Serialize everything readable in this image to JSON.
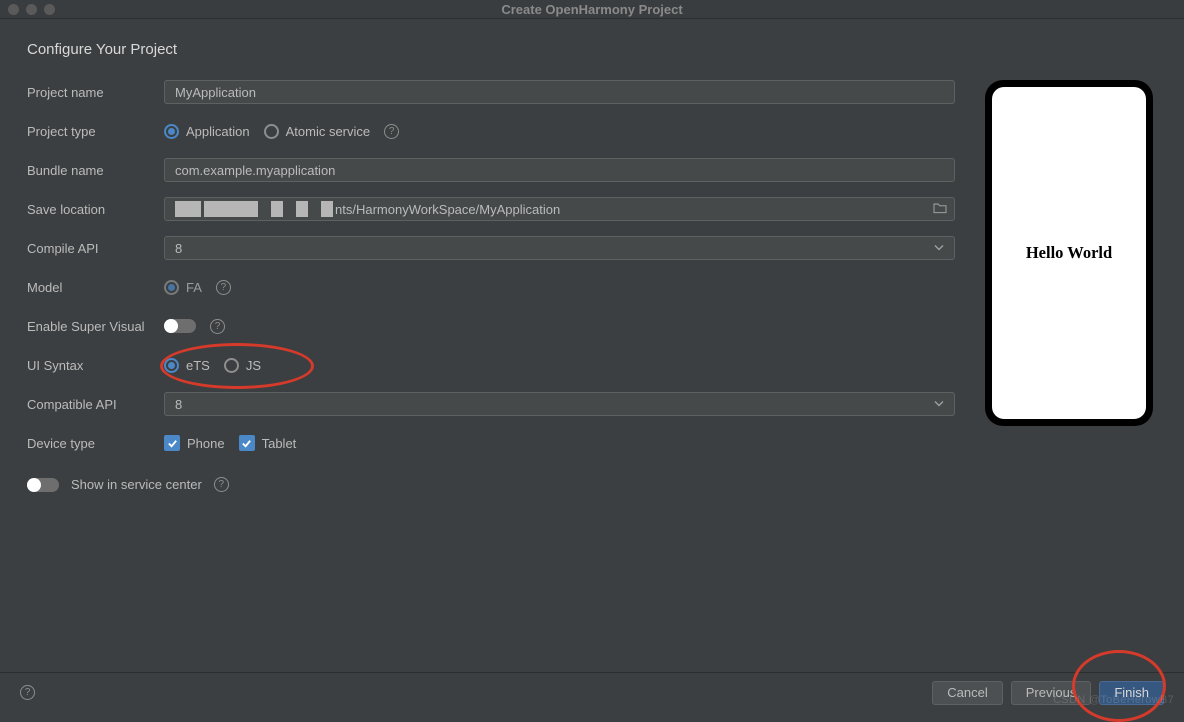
{
  "window": {
    "title": "Create OpenHarmony Project"
  },
  "page": {
    "title": "Configure Your Project"
  },
  "form": {
    "project_name_label": "Project name",
    "project_name_value": "MyApplication",
    "project_type_label": "Project type",
    "project_type_options": {
      "application": "Application",
      "atomic_service": "Atomic service"
    },
    "bundle_name_label": "Bundle name",
    "bundle_name_value": "com.example.myapplication",
    "save_location_label": "Save location",
    "save_location_tail": "nts/HarmonyWorkSpace/MyApplication",
    "compile_api_label": "Compile API",
    "compile_api_value": "8",
    "model_label": "Model",
    "model_options": {
      "fa": "FA"
    },
    "super_visual_label": "Enable Super Visual",
    "ui_syntax_label": "UI Syntax",
    "ui_syntax_options": {
      "ets": "eTS",
      "js": "JS"
    },
    "compatible_api_label": "Compatible API",
    "compatible_api_value": "8",
    "device_type_label": "Device type",
    "device_type_options": {
      "phone": "Phone",
      "tablet": "Tablet"
    },
    "service_center_label": "Show in service center"
  },
  "preview": {
    "text": "Hello World"
  },
  "footer": {
    "cancel": "Cancel",
    "previous": "Previous",
    "finish": "Finish"
  },
  "watermark": "CSDN @ToBeHerowB7"
}
